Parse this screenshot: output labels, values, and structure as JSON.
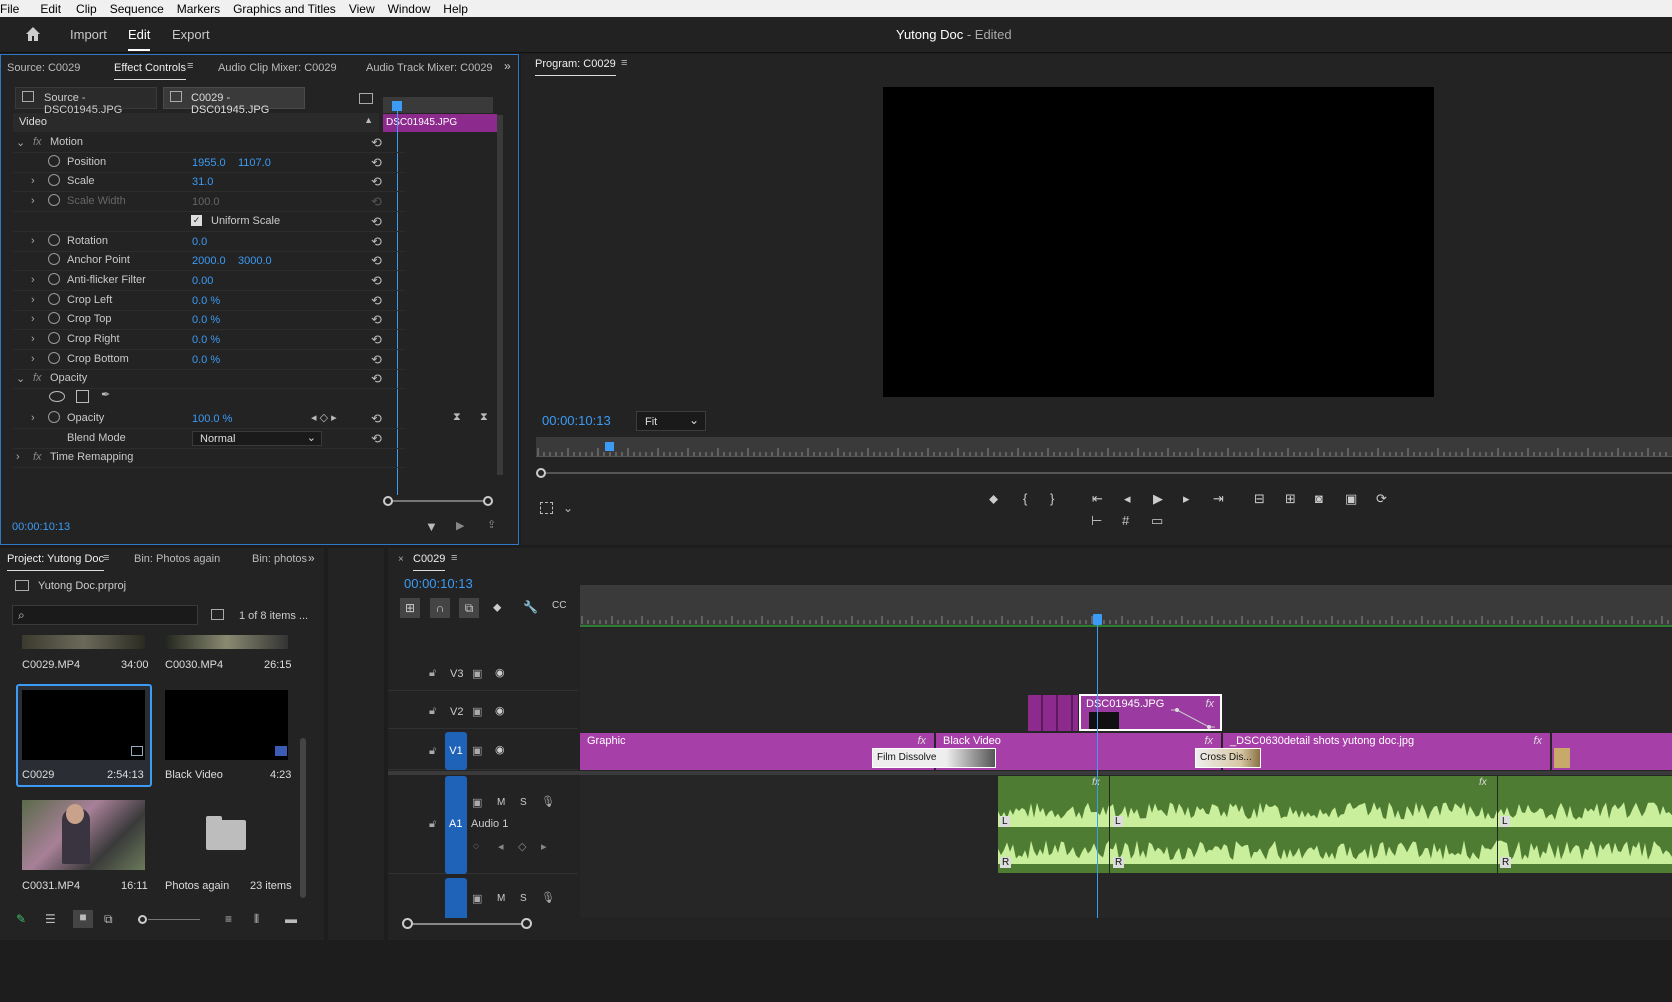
{
  "menu": [
    "File",
    "Edit",
    "Clip",
    "Sequence",
    "Markers",
    "Graphics and Titles",
    "View",
    "Window",
    "Help"
  ],
  "workspace": {
    "home_icon": "home-icon",
    "tabs": [
      "Import",
      "Edit",
      "Export"
    ],
    "active": "Edit",
    "title": "Yutong Doc",
    "title_suffix": " - Edited"
  },
  "source_panel": {
    "tabs": [
      "Source: C0029",
      "Effect Controls",
      "Audio Clip Mixer: C0029",
      "Audio Track Mixer: C0029"
    ],
    "source_chip": "Source - DSC01945.JPG",
    "sequence_chip": "C0029 - DSC01945.JPG",
    "section": "Video",
    "clip_label": "DSC01945.JPG",
    "timecode": "00:00:10:13",
    "effects": [
      {
        "name": "Motion",
        "fx": true
      },
      {
        "name": "Position",
        "v1": "1955.0",
        "v2": "1107.0"
      },
      {
        "name": "Scale",
        "v1": "31.0"
      },
      {
        "name": "Scale Width",
        "v1": "100.0",
        "disabled": true
      },
      {
        "name": "Uniform Scale",
        "checkbox": true
      },
      {
        "name": "Rotation",
        "v1": "0.0"
      },
      {
        "name": "Anchor Point",
        "v1": "2000.0",
        "v2": "3000.0"
      },
      {
        "name": "Anti-flicker Filter",
        "v1": "0.00"
      },
      {
        "name": "Crop Left",
        "v1": "0.0 %"
      },
      {
        "name": "Crop Top",
        "v1": "0.0 %"
      },
      {
        "name": "Crop Right",
        "v1": "0.0 %"
      },
      {
        "name": "Crop Bottom",
        "v1": "0.0 %"
      },
      {
        "name": "Opacity",
        "fx": true
      },
      {
        "name": "Opacity",
        "v1": "100.0 %"
      },
      {
        "name": "Blend Mode",
        "select": "Normal"
      },
      {
        "name": "Time Remapping",
        "fx": true
      }
    ]
  },
  "program": {
    "title": "Program: C0029",
    "timecode": "00:00:10:13",
    "zoom": "Fit"
  },
  "project": {
    "tabs": [
      "Project: Yutong Doc",
      "Bin: Photos again",
      "Bin: photos"
    ],
    "file": "Yutong Doc.prproj",
    "search_placeholder": "",
    "count": "1 of 8 items ...",
    "items": [
      {
        "name": "C0029.MP4",
        "duration": "34:00"
      },
      {
        "name": "C0030.MP4",
        "duration": "26:15"
      },
      {
        "name": "C0029",
        "duration": "2:54:13"
      },
      {
        "name": "Black Video",
        "duration": "4:23"
      },
      {
        "name": "C0031.MP4",
        "duration": "16:11"
      },
      {
        "name": "Photos again",
        "duration": "23 items"
      }
    ]
  },
  "timeline": {
    "sequence": "C0029",
    "timecode": "00:00:10:13",
    "tracks": [
      {
        "id": "V3"
      },
      {
        "id": "V2"
      },
      {
        "id": "V1"
      },
      {
        "id": "A1",
        "name": "Audio 1"
      }
    ],
    "track_buttons": {
      "mute": "M",
      "solo": "S",
      "left": "L",
      "right": "R"
    },
    "clips": {
      "v2": "DSC01945.JPG",
      "v1_a": "Graphic",
      "v1_b": "Black Video",
      "v1_c": "_DSC0630detail shots yutong doc.jpg",
      "transition_a": "Film Dissolve",
      "transition_b": "Cross Dis..."
    }
  },
  "colors": {
    "accent": "#3c9bf5",
    "clip": "#a63fa7",
    "audio": "#4f7c33"
  }
}
